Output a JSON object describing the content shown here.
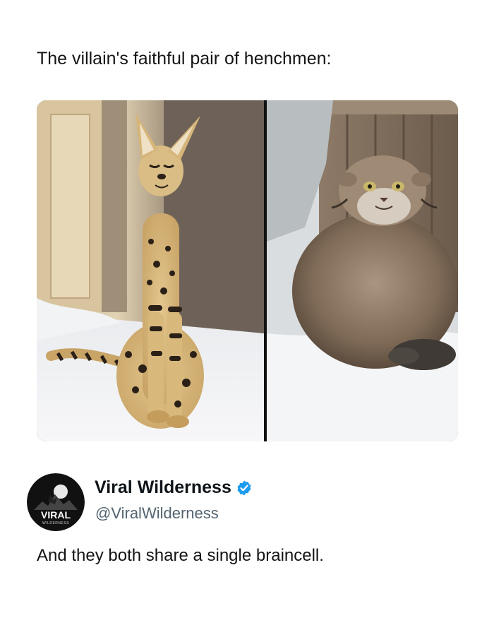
{
  "post": {
    "text": "The villain's faithful pair of henchmen:"
  },
  "media": {
    "left_image": "serval-cat-photo",
    "right_image": "pallas-cat-photo"
  },
  "author": {
    "display_name": "Viral Wilderness",
    "handle": "@ViralWilderness",
    "verified": true,
    "verified_color": "#1d9bf0",
    "avatar_text": "VIRAL",
    "avatar_subtext": "WILDERNESS"
  },
  "reply": {
    "text": "And they both share a single braincell."
  }
}
